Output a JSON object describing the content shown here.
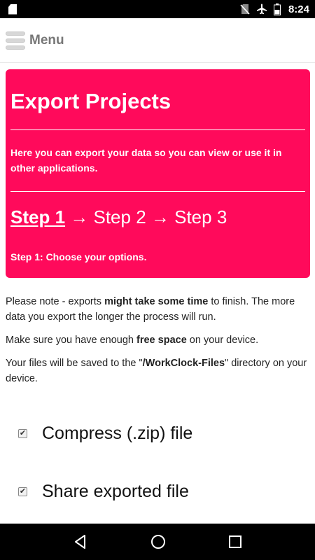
{
  "status_bar": {
    "time": "8:24"
  },
  "app_bar": {
    "menu_label": "Menu"
  },
  "hero": {
    "title": "Export Projects",
    "description": "Here you can export your data so you can view or use it in other applications.",
    "steps": {
      "step1": "Step 1",
      "arrow1": " → ",
      "step2": "Step 2",
      "arrow2": " → ",
      "step3": "Step 3"
    },
    "step_hint": "Step 1: Choose your options."
  },
  "notes": {
    "p1_a": "Please note - exports ",
    "p1_b": "might take some time",
    "p1_c": " to finish. The more data you export the longer the process will run.",
    "p2_a": "Make sure you have enough ",
    "p2_b": "free space",
    "p2_c": " on your device.",
    "p3_a": "Your files will be saved to the \"",
    "p3_b": "/WorkClock-Files",
    "p3_c": "\" directory on your device."
  },
  "options": [
    {
      "label": "Compress (.zip) file",
      "checked": true,
      "check_glyph": "✔"
    },
    {
      "label": "Share exported file",
      "checked": true,
      "check_glyph": "✔"
    }
  ],
  "colors": {
    "accent": "#ff0a5b",
    "status_bar": "#000000",
    "nav_bar": "#000000"
  },
  "icons": {
    "status": [
      "sd-card-icon",
      "no-sim-icon",
      "airplane-icon",
      "battery-icon"
    ],
    "nav": [
      "back-icon",
      "home-icon",
      "recents-icon"
    ],
    "menu": "hamburger-menu-icon"
  }
}
